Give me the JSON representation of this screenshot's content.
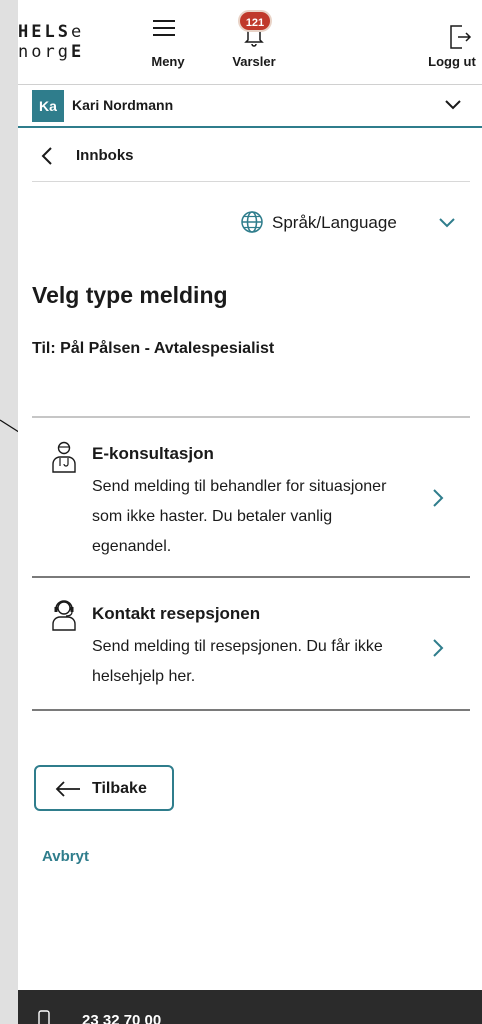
{
  "header": {
    "logo_line1_a": "HELS",
    "logo_line1_b": "e",
    "logo_line2_a": "norg",
    "logo_line2_b": "E",
    "menu_label": "Meny",
    "notifications_label": "Varsler",
    "notifications_count": "121",
    "logout_label": "Logg ut"
  },
  "user": {
    "initials": "Ka",
    "name": "Kari Nordmann"
  },
  "breadcrumb": {
    "back_label": "Innboks"
  },
  "language": {
    "label": "Språk/Language"
  },
  "page": {
    "title": "Velg type melding",
    "recipient": "Til: Pål Pålsen - Avtalespesialist"
  },
  "options": [
    {
      "title": "E-konsultasjon",
      "description": "Send melding til behandler for situasjoner som ikke haster. Du betaler vanlig egenandel."
    },
    {
      "title": "Kontakt resepsjonen",
      "description": "Send melding til resepsjonen. Du får ikke helsehjelp her."
    }
  ],
  "actions": {
    "back_label": "Tilbake",
    "cancel_label": "Avbryt"
  },
  "footer": {
    "phone": "23 32 70 00"
  },
  "colors": {
    "accent": "#2f7d8c",
    "badge": "#c0392b",
    "footer_bg": "#2b2b2b"
  }
}
